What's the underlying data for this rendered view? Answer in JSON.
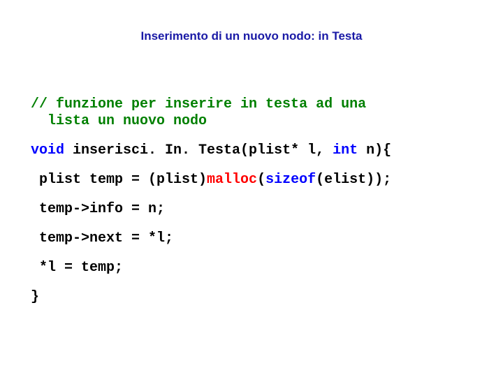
{
  "title": "Inserimento di un nuovo nodo: in Testa",
  "code": {
    "comment_line1": "// funzione per inserire in testa ad una",
    "comment_line2": "  lista un nuovo nodo",
    "sig_void": "void",
    "sig_rest": " inserisci. In. Testa(plist* l, ",
    "sig_int": "int",
    "sig_end": " n){",
    "line_temp_a": " plist temp = (plist)",
    "line_temp_malloc": "malloc",
    "line_temp_b": "(",
    "line_temp_sizeof": "sizeof",
    "line_temp_c": "(elist));",
    "line_info": " temp->info = n;",
    "line_next": " temp->next = *l;",
    "line_assign": " *l = temp;",
    "line_close": "}"
  }
}
